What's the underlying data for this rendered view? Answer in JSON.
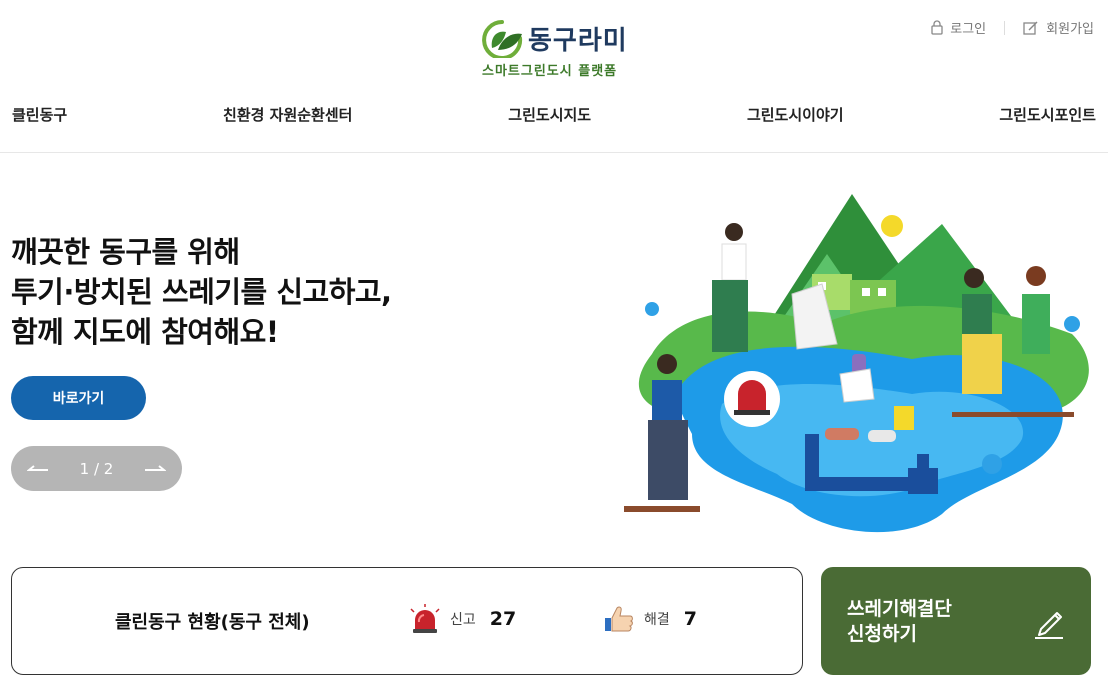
{
  "header": {
    "brand_name": "동구라미",
    "brand_tagline": "스마트그린도시 플랫폼",
    "login_label": "로그인",
    "signup_label": "회원가입"
  },
  "nav": {
    "items": [
      {
        "label": "클린동구"
      },
      {
        "label": "친환경 자원순환센터"
      },
      {
        "label": "그린도시지도"
      },
      {
        "label": "그린도시이야기"
      },
      {
        "label": "그린도시포인트"
      }
    ]
  },
  "hero": {
    "lines": [
      "깨끗한 동구를 위해",
      "투기·방치된 쓰레기를 신고하고,",
      "함께 지도에 참여해요!"
    ],
    "cta_label": "바로가기",
    "pager_text": "1 / 2"
  },
  "status": {
    "title": "클린동구 현황(동구 전체)",
    "report_label": "신고",
    "report_value": "27",
    "resolved_label": "해결",
    "resolved_value": "7"
  },
  "apply": {
    "line1": "쓰레기해결단",
    "line2": "신청하기"
  },
  "colors": {
    "primary_blue": "#1565ad",
    "brand_green": "#4a6b35",
    "pager_gray": "#b5b5b5",
    "title_navy": "#1f3a5f"
  },
  "icons": [
    "logo-leaf-icon",
    "lock-icon",
    "edit-icon",
    "arrow-left-icon",
    "arrow-right-icon",
    "siren-icon",
    "thumbs-up-icon",
    "pencil-icon"
  ]
}
